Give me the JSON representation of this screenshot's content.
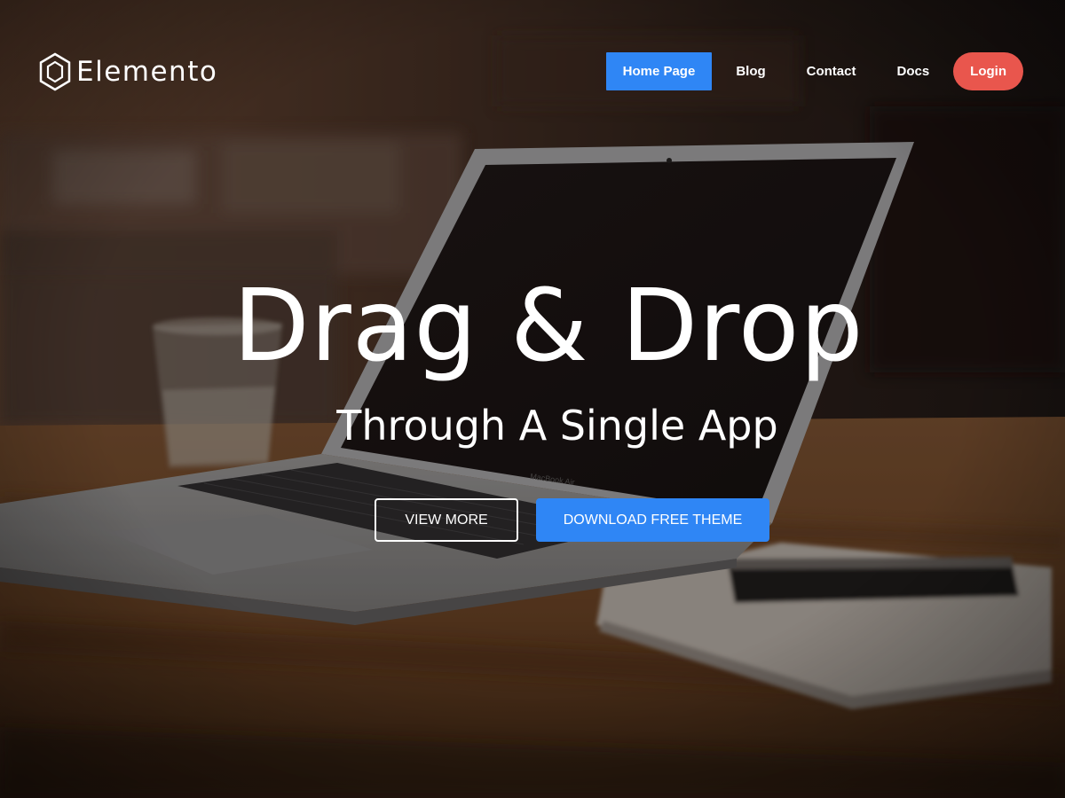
{
  "header": {
    "brand_name": "Elemento",
    "nav": [
      {
        "label": "Home Page",
        "active": true
      },
      {
        "label": "Blog",
        "active": false
      },
      {
        "label": "Contact",
        "active": false
      },
      {
        "label": "Docs",
        "active": false
      },
      {
        "label": "Login",
        "active": false
      }
    ]
  },
  "hero": {
    "title": "Drag & Drop",
    "subtitle": "Through A Single App",
    "buttons": {
      "secondary_label": "VIEW MORE",
      "primary_label": "DOWNLOAD FREE THEME"
    },
    "laptop_label": "MacBook Air"
  },
  "colors": {
    "accent": "#2f86f5",
    "login": "#e9564d",
    "text": "#ffffff"
  },
  "icons": {
    "brand_logo": "hexagon-logo-icon"
  }
}
